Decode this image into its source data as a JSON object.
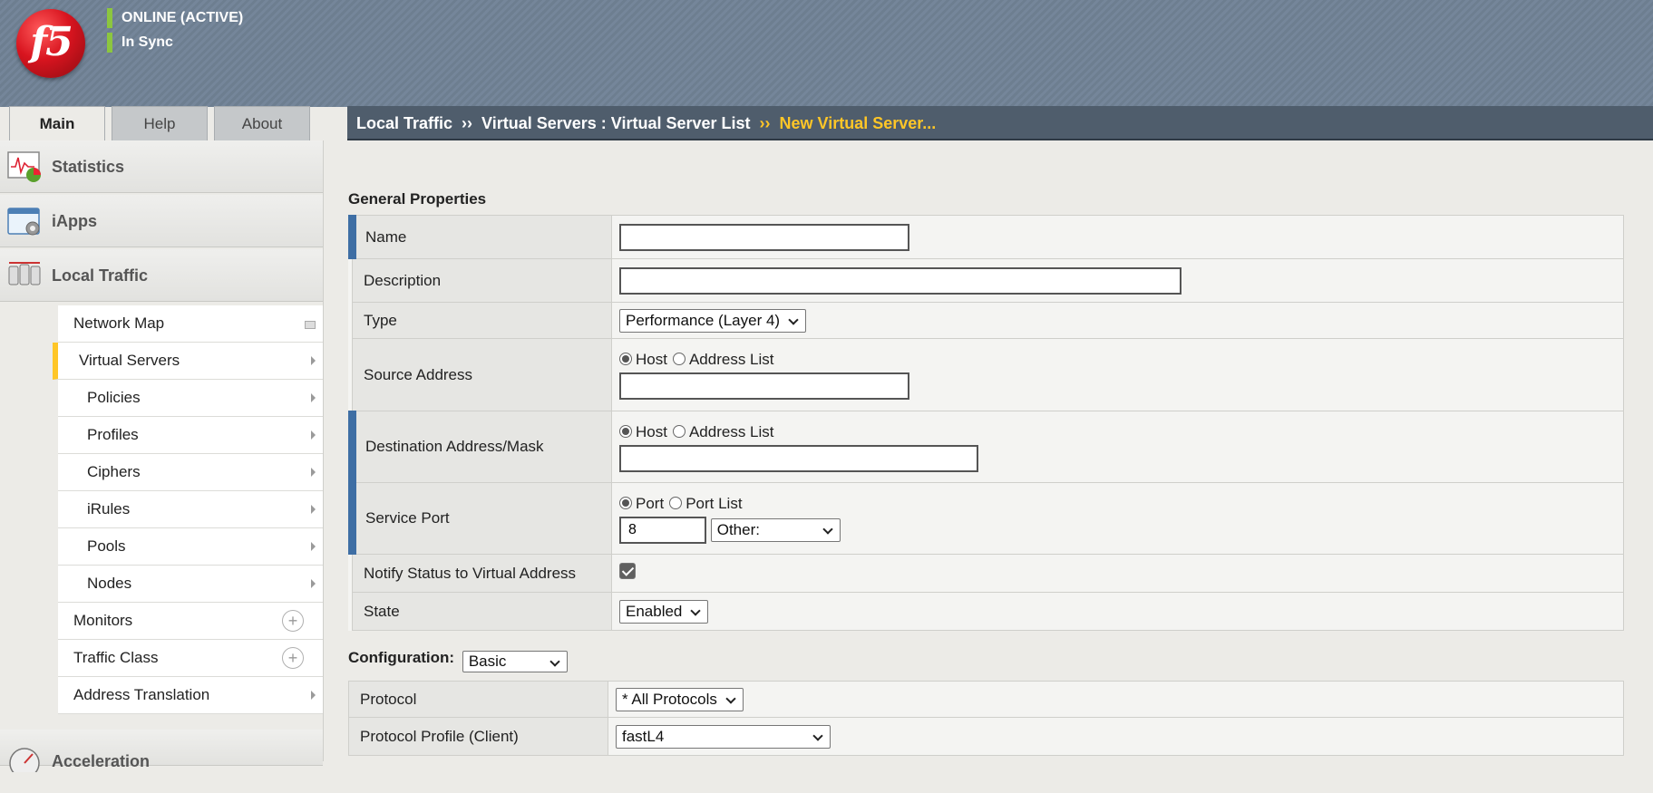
{
  "header": {
    "status_line1": "ONLINE (ACTIVE)",
    "status_line2": "In Sync",
    "logo_text": "f5",
    "accent_color": "#8cc63f"
  },
  "tabs": [
    {
      "label": "Main",
      "active": true
    },
    {
      "label": "Help",
      "active": false
    },
    {
      "label": "About",
      "active": false
    }
  ],
  "breadcrumb": {
    "part1": "Local Traffic",
    "part2": "Virtual Servers : Virtual Server List",
    "current": "New Virtual Server...",
    "separator": "››"
  },
  "sidebar": {
    "sections": [
      {
        "label": "Statistics",
        "icon": "statistics-icon"
      },
      {
        "label": "iApps",
        "icon": "iapps-icon"
      },
      {
        "label": "Local Traffic",
        "icon": "local-traffic-icon"
      }
    ],
    "items": [
      {
        "label": "Network Map"
      },
      {
        "label": "Virtual Servers",
        "selected": true
      },
      {
        "label": "Policies"
      },
      {
        "label": "Profiles"
      },
      {
        "label": "Ciphers"
      },
      {
        "label": "iRules"
      },
      {
        "label": "Pools"
      },
      {
        "label": "Nodes"
      },
      {
        "label": "Monitors"
      },
      {
        "label": "Traffic Class"
      },
      {
        "label": "Address Translation"
      }
    ],
    "next_section": "Acceleration"
  },
  "general": {
    "title": "General Properties",
    "name_label": "Name",
    "name_value": "",
    "description_label": "Description",
    "description_value": "",
    "type_label": "Type",
    "type_value": "Performance (Layer 4)",
    "source_label": "Source Address",
    "source_opt1": "Host",
    "source_opt2": "Address List",
    "source_value": "",
    "dest_label": "Destination Address/Mask",
    "dest_opt1": "Host",
    "dest_opt2": "Address List",
    "dest_value": "",
    "port_label": "Service Port",
    "port_opt1": "Port",
    "port_opt2": "Port List",
    "port_value": "8",
    "port_select": "Other:",
    "notify_label": "Notify Status to Virtual Address",
    "notify_checked": true,
    "state_label": "State",
    "state_value": "Enabled"
  },
  "configuration": {
    "title": "Configuration:",
    "mode": "Basic",
    "protocol_label": "Protocol",
    "protocol_value": "* All Protocols",
    "profile_label": "Protocol Profile (Client)",
    "profile_value": "fastL4"
  },
  "colors": {
    "breadcrumb_current": "#ffc627",
    "required_marker": "#3e6ea4",
    "selected_marker": "#ffc627"
  }
}
